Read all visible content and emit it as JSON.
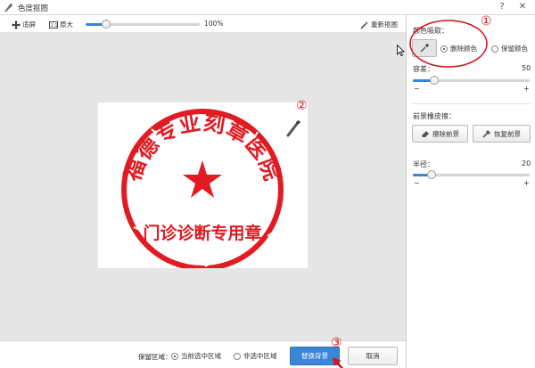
{
  "window": {
    "title": "色度抠图",
    "help_glyph": "?",
    "close_glyph": "✕"
  },
  "toolbar": {
    "fit_label": "适屏",
    "zoom_label": "原大",
    "zoom_percent": "100%",
    "zoom_level": 0.18,
    "reselect_label": "重新抠图"
  },
  "stamp": {
    "outer_text": "福德专业刻章医院",
    "inner_text": "门诊诊断专用章",
    "color": "#e11b22"
  },
  "annotations": {
    "one": "①",
    "two": "②",
    "three": "③",
    "color": "#d8121a"
  },
  "panel": {
    "pick_color_label": "颜色吸取：",
    "remove_color_label": "删除颜色",
    "keep_color_label": "保留颜色",
    "tolerance_label": "容差：",
    "tolerance_value": "50",
    "tolerance_level": 0.18,
    "minus": "−",
    "plus": "+",
    "bg_eraser_label": "前景橡皮擦：",
    "erase_fg_label": "擦除前景",
    "restore_fg_label": "恢复前景",
    "radius_label": "半径：",
    "radius_value": "20",
    "radius_level": 0.16
  },
  "bottom": {
    "keep_area_label": "保留区域：",
    "current_selection_label": "当前选中区域",
    "non_selection_label": "非选中区域",
    "replace_bg_label": "替换背景",
    "cancel_label": "取消"
  }
}
